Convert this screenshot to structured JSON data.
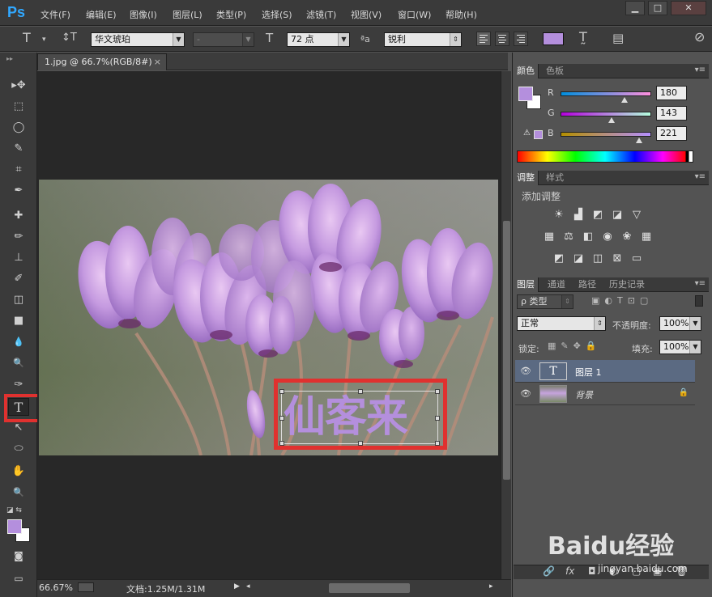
{
  "app": {
    "logo": "Ps"
  },
  "menu": [
    "文件(F)",
    "编辑(E)",
    "图像(I)",
    "图层(L)",
    "类型(P)",
    "选择(S)",
    "滤镜(T)",
    "视图(V)",
    "窗口(W)",
    "帮助(H)"
  ],
  "window_controls": {
    "minimize": "▁",
    "restore": "□",
    "close": "✕"
  },
  "options": {
    "tool_icon": "T",
    "orient_icon": "↕T",
    "font_family": "华文琥珀",
    "font_style": "-",
    "size_icon": "T",
    "font_size": "72 点",
    "aa_icon": "ªa",
    "antialias": "锐利",
    "text_color": "#b48fdd",
    "warp_icon": "T̰",
    "panels_icon": "▤",
    "cancel_icon": "⊘"
  },
  "document": {
    "tab_title": "1.jpg @ 66.7%(RGB/8#)",
    "close": "×",
    "art_text": "仙客来",
    "text_color": "#b48fdd"
  },
  "toolbar": {
    "tools": [
      "move",
      "marquee",
      "lasso",
      "quick-select",
      "crop",
      "eyedropper",
      "healing",
      "brush",
      "stamp",
      "history-brush",
      "eraser",
      "gradient",
      "blur",
      "dodge",
      "pen",
      "type",
      "path-select",
      "ellipse",
      "hand",
      "zoom"
    ],
    "glyphs": [
      "▸✥",
      "⬚",
      "◯",
      "✎",
      "⌗",
      "✒",
      "✚",
      "✏",
      "⊥",
      "✐",
      "◫",
      "■",
      "💧",
      "🔍",
      "✑",
      "T",
      "↖",
      "⬭",
      "✋",
      "🔍"
    ],
    "fg_color": "#b48fdd",
    "bg_color": "#ffffff"
  },
  "status": {
    "zoom": "66.67%",
    "doc_size": "文档:1.25M/1.31M",
    "arrow": "▶",
    "scroll_left": "◂",
    "scroll_right": "▸"
  },
  "color_panel": {
    "tabs": [
      "颜色",
      "色板"
    ],
    "r_label": "R",
    "r": "180",
    "g_label": "G",
    "g": "143",
    "b_label": "B",
    "b": "221",
    "r_fraction": 0.706,
    "g_fraction": 0.561,
    "b_fraction": 0.867,
    "warn": "⚠"
  },
  "adjust_panel": {
    "tabs": [
      "调整",
      "样式"
    ],
    "title": "添加调整",
    "row1": [
      "☀",
      "▟",
      "◩",
      "◪",
      "▽"
    ],
    "row2": [
      "▦",
      "⚖",
      "◧",
      "◉",
      "❀",
      "▦"
    ],
    "row3": [
      "◩",
      "◪",
      "◫",
      "⊠",
      "▭"
    ]
  },
  "layers_panel": {
    "tabs": [
      "图层",
      "通道",
      "路径",
      "历史记录"
    ],
    "filter_label": "ρ 类型",
    "blend_mode": "正常",
    "opacity_label": "不透明度:",
    "opacity": "100%",
    "lock_label": "锁定:",
    "fill_label": "填充:",
    "fill": "100%",
    "layers": [
      {
        "name": "图层 1",
        "type": "text",
        "thumb": "T"
      },
      {
        "name": "背景",
        "type": "image",
        "lock": "🔒"
      }
    ],
    "eye": "👁",
    "bottom_icons": [
      "🔗",
      "fx",
      "◘",
      "◐",
      "▢",
      "▣",
      "🗑"
    ]
  },
  "watermark": {
    "logo": "Baidu经验",
    "url": "jingyan.baidu.com"
  }
}
